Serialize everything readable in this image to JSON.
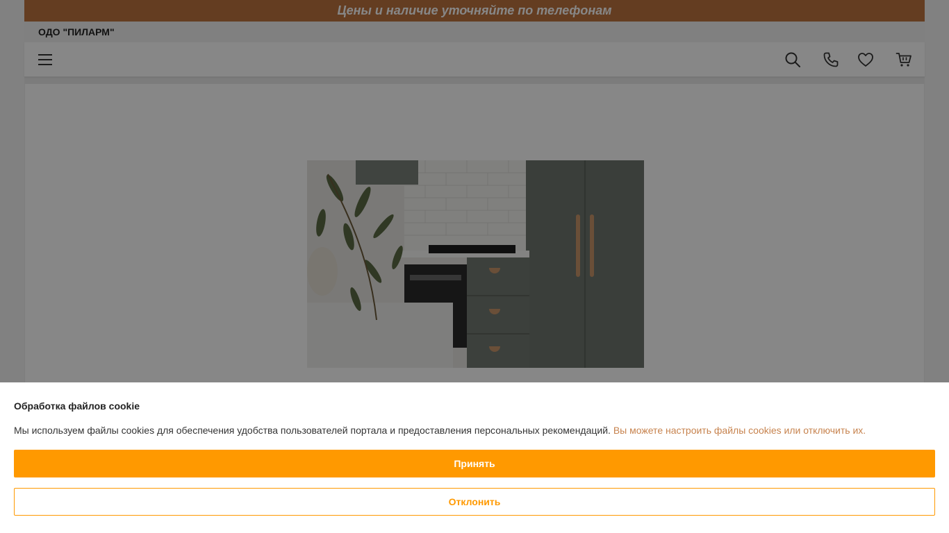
{
  "topbar": {
    "notice": "Цены и наличие уточняйте по телефонам"
  },
  "header": {
    "company": "ОДО \"ПИЛАРМ\""
  },
  "navbar": {
    "menu_icon": "hamburger-menu-icon",
    "actions": [
      {
        "icon": "search-icon"
      },
      {
        "icon": "phone-icon"
      },
      {
        "icon": "heart-icon"
      },
      {
        "icon": "cart-icon"
      }
    ]
  },
  "banner": {
    "image": "kitchen-interior-photo"
  },
  "cookie": {
    "title": "Обработка файлов cookie",
    "text": "Мы используем файлы cookies для обеспечения удобства пользователей портала и предоставления персональных рекомендаций.",
    "link": "Вы можете настроить файлы cookies или отключить их.",
    "accept_label": "Принять",
    "decline_label": "Отклонить"
  },
  "colors": {
    "topbar_bg": "#bd733f",
    "accent": "#ff9900",
    "link": "#c7834e"
  }
}
